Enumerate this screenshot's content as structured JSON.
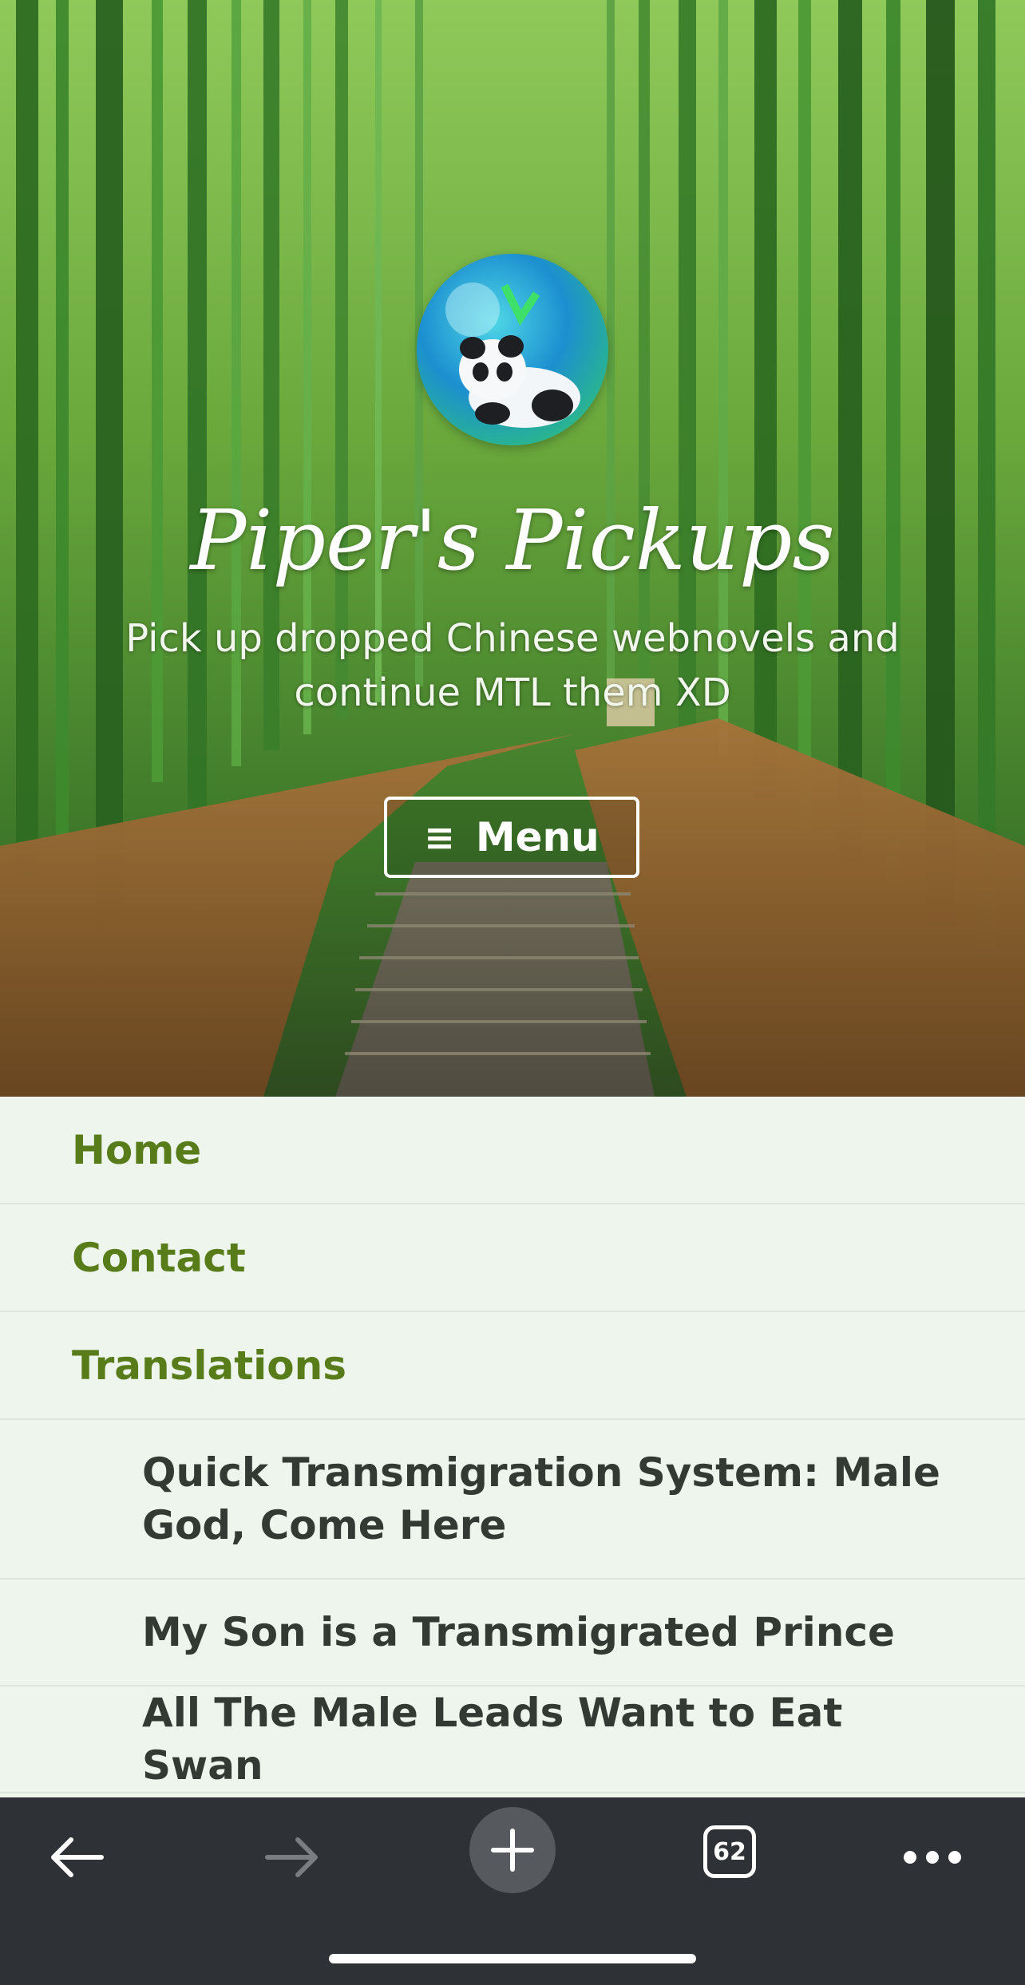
{
  "header": {
    "site_title": "Piper's Pickups",
    "tagline": "Pick up dropped Chinese webnovels and continue MTL them XD",
    "menu_button": {
      "icon": "hamburger-icon",
      "glyph": "≡",
      "label": "Menu"
    },
    "colors": {
      "title": "#ffffff",
      "button_border": "#ffffff"
    }
  },
  "nav": {
    "items": [
      {
        "label": "Home"
      },
      {
        "label": "Contact"
      },
      {
        "label": "Translations"
      }
    ],
    "translations": [
      {
        "label": "Quick Transmigration System: Male God, Come Here"
      },
      {
        "label": "My Son is a Transmigrated Prince"
      },
      {
        "label": "All The Male Leads Want to Eat Swan"
      }
    ],
    "colors": {
      "link": "#587c1a",
      "sublink": "#333a33",
      "background": "#eef5ec"
    }
  },
  "browser_bar": {
    "tab_count": "62",
    "icons": [
      "back-arrow-icon",
      "forward-arrow-icon",
      "plus-icon",
      "tabs-icon",
      "more-icon"
    ],
    "colors": {
      "background": "#2e3135",
      "disabled": "#7a7d82",
      "enabled": "#ffffff"
    }
  }
}
